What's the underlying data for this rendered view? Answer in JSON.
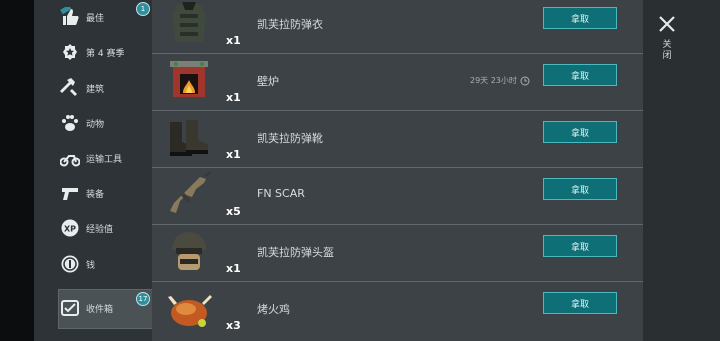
{
  "sidebar": {
    "items": [
      {
        "label": "最佳",
        "icon": "thumbs-up-icon",
        "badge": "1"
      },
      {
        "label": "第 4 赛季",
        "icon": "season-badge-icon"
      },
      {
        "label": "建筑",
        "icon": "hammer-wrench-icon"
      },
      {
        "label": "动物",
        "icon": "paw-icon"
      },
      {
        "label": "运输工具",
        "icon": "motorcycle-icon"
      },
      {
        "label": "装备",
        "icon": "pistol-icon"
      },
      {
        "label": "经验值",
        "icon": "xp-icon"
      },
      {
        "label": "钱",
        "icon": "coin-icon"
      },
      {
        "label": "收件箱",
        "icon": "inbox-icon",
        "badge": "17"
      }
    ],
    "selected": "收件箱"
  },
  "rewards": [
    {
      "name": "凯芙拉防弹衣",
      "qty": "x1",
      "icon": "kevlar-vest-icon",
      "button": "拿取"
    },
    {
      "name": "壁炉",
      "qty": "x1",
      "icon": "fireplace-icon",
      "timer": "29天 23小时",
      "button": "拿取"
    },
    {
      "name": "凯芙拉防弹靴",
      "qty": "x1",
      "icon": "kevlar-boots-icon",
      "button": "拿取"
    },
    {
      "name": "FN SCAR",
      "qty": "x5",
      "icon": "rifle-icon",
      "button": "拿取"
    },
    {
      "name": "凯芙拉防弹头盔",
      "qty": "x1",
      "icon": "kevlar-helmet-icon",
      "button": "拿取"
    },
    {
      "name": "烤火鸡",
      "qty": "x3",
      "icon": "roast-turkey-icon",
      "button": "拿取"
    }
  ],
  "close": {
    "label": "关闭",
    "icon": "close-icon"
  },
  "colors": {
    "button": "#0f6f76",
    "button_border": "#49b8bf",
    "badge": "#2f8f9c"
  }
}
